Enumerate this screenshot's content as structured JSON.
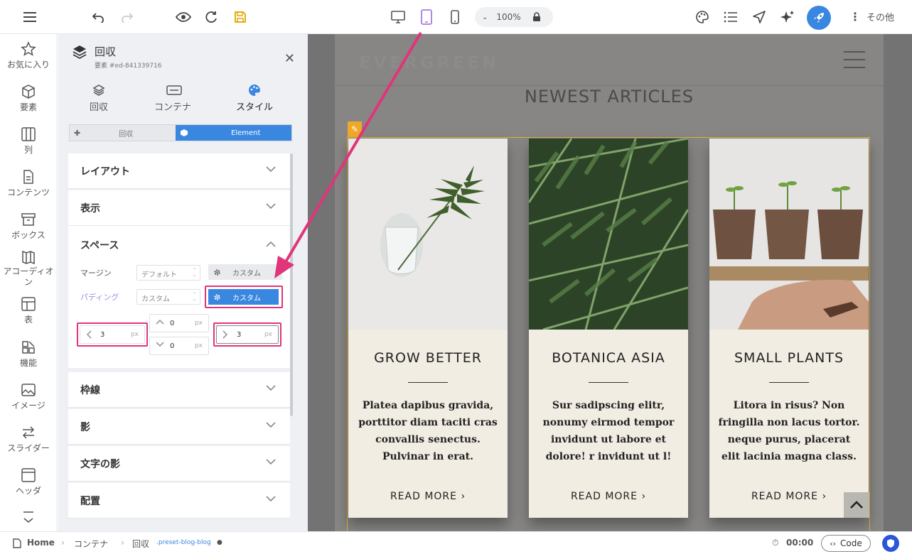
{
  "toolbar": {
    "zoom": "100%",
    "more_label": "その他"
  },
  "leftbar": {
    "items": [
      {
        "label": "お気に入り",
        "icon": "star-icon"
      },
      {
        "label": "要素",
        "icon": "cube-icon"
      },
      {
        "label": "列",
        "icon": "columns-icon"
      },
      {
        "label": "コンテンツ",
        "icon": "document-icon"
      },
      {
        "label": "ボックス",
        "icon": "box-icon"
      },
      {
        "label": "アコーディオン",
        "icon": "accordion-icon"
      },
      {
        "label": "表",
        "icon": "table-icon"
      },
      {
        "label": "機能",
        "icon": "features-icon"
      },
      {
        "label": "イメージ",
        "icon": "image-icon"
      },
      {
        "label": "スライダー",
        "icon": "slider-icon"
      },
      {
        "label": "ヘッダ",
        "icon": "header-icon"
      }
    ]
  },
  "panel": {
    "title": "回収",
    "subtitle": "要素 #ed-841339716",
    "tabs": [
      {
        "label": "回収",
        "icon": "layers-icon"
      },
      {
        "label": "コンテナ",
        "icon": "container-icon"
      },
      {
        "label": "スタイル",
        "icon": "palette-icon"
      }
    ],
    "segment": {
      "left": "回収",
      "right": "Element"
    },
    "sections": {
      "layout": "レイアウト",
      "display": "表示",
      "space": "スペース",
      "border": "枠線",
      "shadow": "影",
      "text_shadow": "文字の影",
      "placement": "配置"
    },
    "space": {
      "margin_label": "マージン",
      "margin_select": "デフォルト",
      "margin_custom": "カスタム",
      "padding_label": "パディング",
      "padding_select": "カスタム",
      "padding_custom": "カスタム",
      "left_value": "3",
      "top_value": "0",
      "bottom_value": "0",
      "right_value": "3",
      "unit": "px"
    }
  },
  "site": {
    "logo": "EVERGREEN",
    "heading": "NEWEST ARTICLES",
    "cards": [
      {
        "title": "GROW BETTER",
        "body": "Platea dapibus gravida, porttitor diam taciti cras convallis senectus. Pulvinar in erat.",
        "link": "READ MORE ›"
      },
      {
        "title": "BOTANICA ASIA",
        "body": "Sur sadipscing elitr, nonumy eirmod tempor invidunt ut labore et dolore! r invidunt ut l!",
        "link": "READ MORE ›"
      },
      {
        "title": "SMALL PLANTS",
        "body": "Litora in risus? Non fringilla non lacus tortor. neque purus, placerat elit lacinia magna class.",
        "link": "READ MORE ›"
      }
    ]
  },
  "status": {
    "breadcrumb": [
      "Home",
      "コンテナ",
      "回収"
    ],
    "preset": ".preset-blog-blog",
    "time": "00:00",
    "code_label": "Code"
  },
  "colors": {
    "accent": "#3a87e0",
    "highlight": "#e0357a",
    "tablet_icon": "#a87ce0",
    "save_icon": "#e0a800"
  }
}
